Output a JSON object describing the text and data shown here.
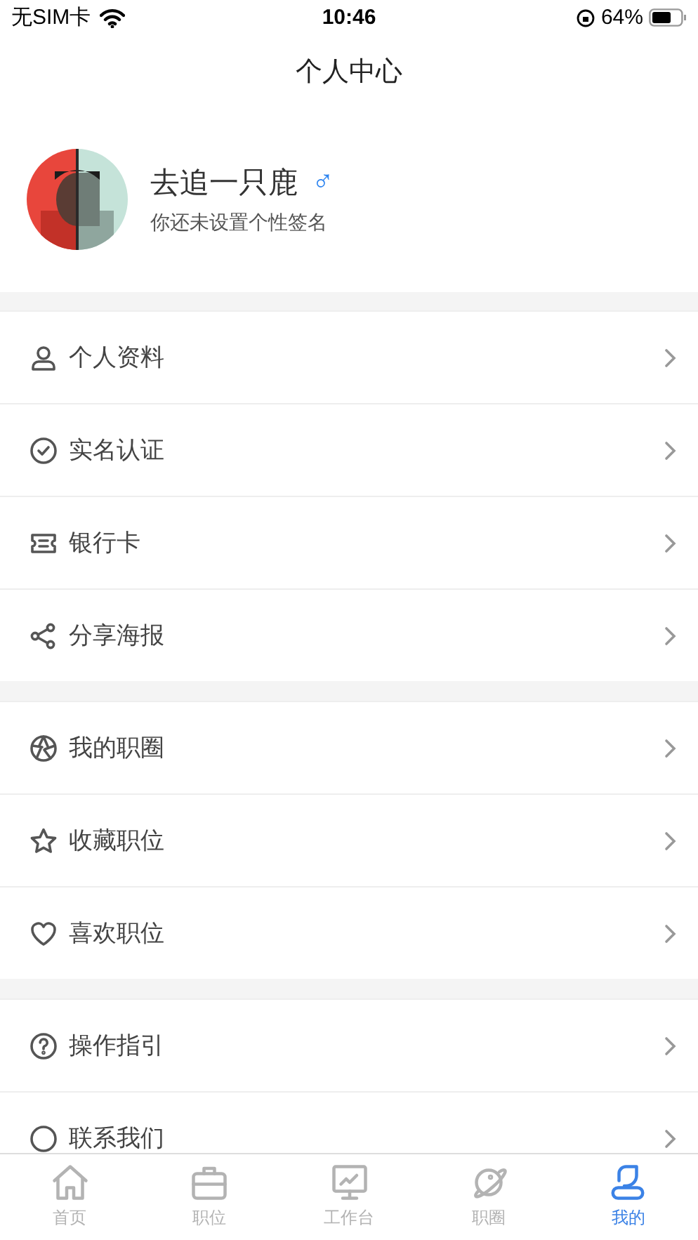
{
  "status_bar": {
    "carrier": "无SIM卡",
    "time": "10:46",
    "battery": "64%"
  },
  "header": {
    "title": "个人中心"
  },
  "profile": {
    "name": "去追一只鹿",
    "gender": "♂",
    "signature": "你还未设置个性签名"
  },
  "menu_groups": [
    {
      "items": [
        {
          "label": "个人资料"
        },
        {
          "label": "实名认证"
        },
        {
          "label": "银行卡"
        },
        {
          "label": "分享海报"
        }
      ]
    },
    {
      "items": [
        {
          "label": "我的职圈"
        },
        {
          "label": "收藏职位"
        },
        {
          "label": "喜欢职位"
        }
      ]
    },
    {
      "items": [
        {
          "label": "操作指引"
        },
        {
          "label": "联系我们"
        }
      ]
    }
  ],
  "tab_bar": [
    {
      "label": "首页",
      "selected": false
    },
    {
      "label": "职位",
      "selected": false
    },
    {
      "label": "工作台",
      "selected": false
    },
    {
      "label": "职圈",
      "selected": false
    },
    {
      "label": "我的",
      "selected": true
    }
  ]
}
